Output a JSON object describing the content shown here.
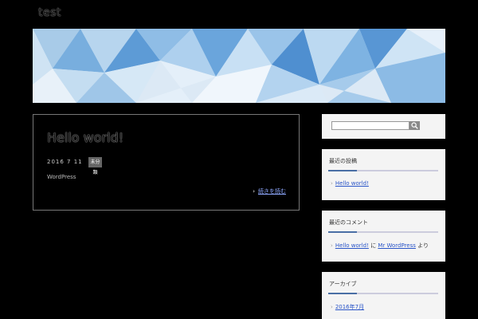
{
  "site": {
    "title": "test"
  },
  "post": {
    "title": "Hello world!",
    "date": "2016 7 11",
    "category": "未分類",
    "body": "WordPress",
    "more": "続きを読む"
  },
  "sidebar": {
    "search": {
      "placeholder": ""
    },
    "recent_posts": {
      "heading": "最近の投稿",
      "items": [
        "Hello world!"
      ]
    },
    "recent_comments": {
      "heading": "最近のコメント",
      "item_link1": "Hello world!",
      "item_sep": "に",
      "item_link2": "Mr WordPress",
      "item_suffix": "より"
    },
    "archives": {
      "heading": "アーカイブ",
      "items": [
        "2016年7月"
      ]
    }
  }
}
